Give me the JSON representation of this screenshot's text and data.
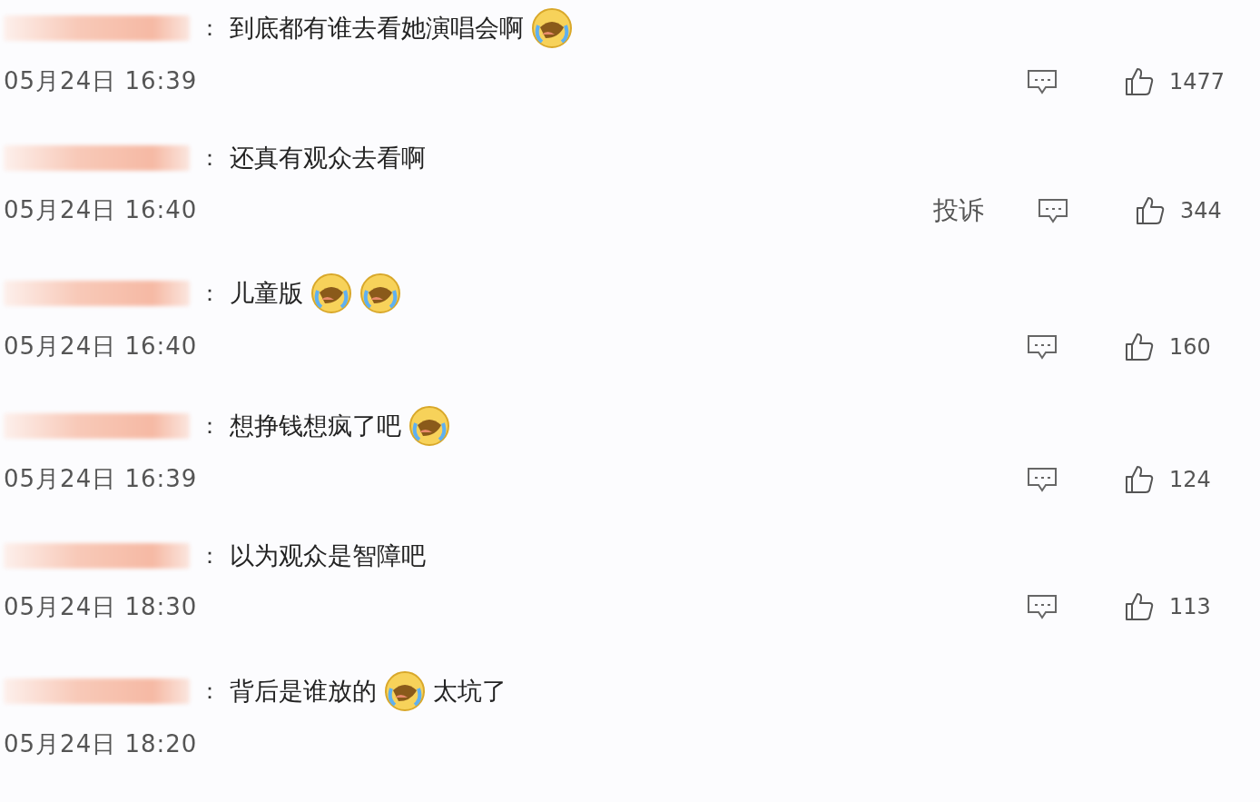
{
  "comments": [
    {
      "separator": "：",
      "parts": [
        {
          "kind": "text",
          "text": "到底都有谁去看她演唱会啊"
        },
        {
          "kind": "emoji"
        }
      ],
      "time": "05月24日 16:39",
      "likes": "1477"
    },
    {
      "separator": "：",
      "parts": [
        {
          "kind": "text",
          "text": "还真有观众去看啊"
        }
      ],
      "time": "05月24日 16:40",
      "report": "投诉",
      "likes": "344"
    },
    {
      "separator": "：",
      "parts": [
        {
          "kind": "text",
          "text": "儿童版"
        },
        {
          "kind": "emoji"
        },
        {
          "kind": "emoji"
        }
      ],
      "time": "05月24日 16:40",
      "likes": "160"
    },
    {
      "separator": "：",
      "parts": [
        {
          "kind": "text",
          "text": "想挣钱想疯了吧"
        },
        {
          "kind": "emoji"
        }
      ],
      "time": "05月24日 16:39",
      "likes": "124"
    },
    {
      "separator": "：",
      "parts": [
        {
          "kind": "text",
          "text": "以为观众是智障吧"
        }
      ],
      "time": "05月24日 18:30",
      "likes": "113"
    },
    {
      "separator": "：",
      "parts": [
        {
          "kind": "text",
          "text": "背后是谁放的"
        },
        {
          "kind": "emoji"
        },
        {
          "kind": "text",
          "text": "太坑了"
        }
      ],
      "time": "05月24日 18:20"
    }
  ]
}
